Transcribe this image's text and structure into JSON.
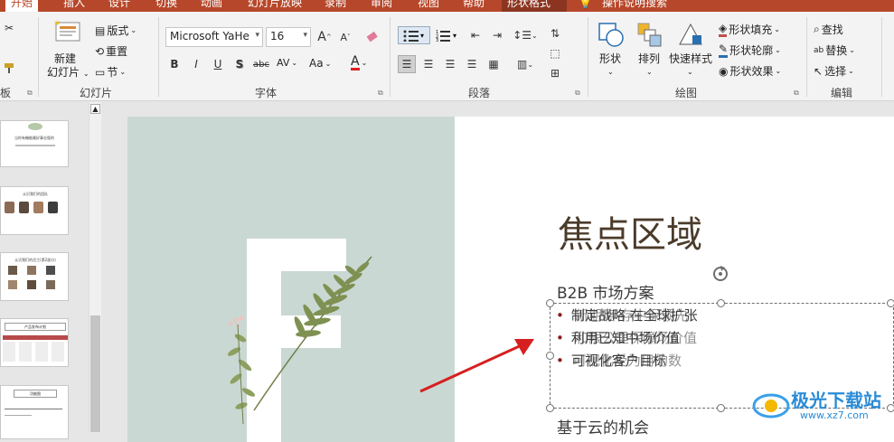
{
  "tabs": [
    {
      "label": "开始",
      "active": true
    },
    {
      "label": "插入"
    },
    {
      "label": "设计"
    },
    {
      "label": "切换"
    },
    {
      "label": "动画"
    },
    {
      "label": "幻灯片放映"
    },
    {
      "label": "录制"
    },
    {
      "label": "审阅"
    },
    {
      "label": "视图"
    },
    {
      "label": "帮助"
    },
    {
      "label": "形状格式",
      "contextual": true
    },
    {
      "label": "操作说明搜索"
    }
  ],
  "ribbon": {
    "slides": {
      "new_slide_1": "新建",
      "new_slide_2": "幻灯片",
      "layout": "版式",
      "reset": "重置",
      "section": "节",
      "group_label": "幻灯片"
    },
    "font": {
      "font_name": "Microsoft YaHe",
      "font_size": "16",
      "bold": "B",
      "italic": "I",
      "underline": "U",
      "shadow": "S",
      "strike": "abc",
      "spacing": "AV",
      "case": "Aa",
      "color": "A",
      "grow": "A",
      "shrink": "A",
      "group_label": "字体"
    },
    "paragraph": {
      "group_label": "段落"
    },
    "drawing": {
      "shapes": "形状",
      "arrange": "排列",
      "quick_styles": "快速样式",
      "fill": "形状填充",
      "outline": "形状轮廓",
      "effects": "形状效果",
      "group_label": "绘图"
    },
    "editing": {
      "find": "查找",
      "replace": "替换",
      "select": "选择",
      "group_label": "编辑"
    }
  },
  "slide": {
    "title": "焦点区域",
    "subhead": "B2B 市场方案",
    "bullets": [
      "制定战略 在全球扩张",
      "利用已知中场价值",
      "可视化客户目标"
    ],
    "ghost_lines": [
      "新期略 存中保领先",
      "和限公里保障场价值",
      "可视化受为用的数"
    ],
    "subhead2": "基于云的机会",
    "accent_color": "#8b1c1c",
    "panel_color": "#cad8d3"
  },
  "thumbnails": {
    "t1_text": "当你有機能最好事业版的",
    "t2_text": "认识我们的团队",
    "t3_text": "认识我们的员工(第2部分)",
    "t4_text": "产品发布计划",
    "t5_text": "功能图"
  },
  "watermark": {
    "text": "极光下载站",
    "url": "www.xz7.com"
  },
  "colors": {
    "ribbon_tab_bg": "#b7472a",
    "ribbon_bg": "#f3f3f3",
    "arrow": "#d62020"
  }
}
